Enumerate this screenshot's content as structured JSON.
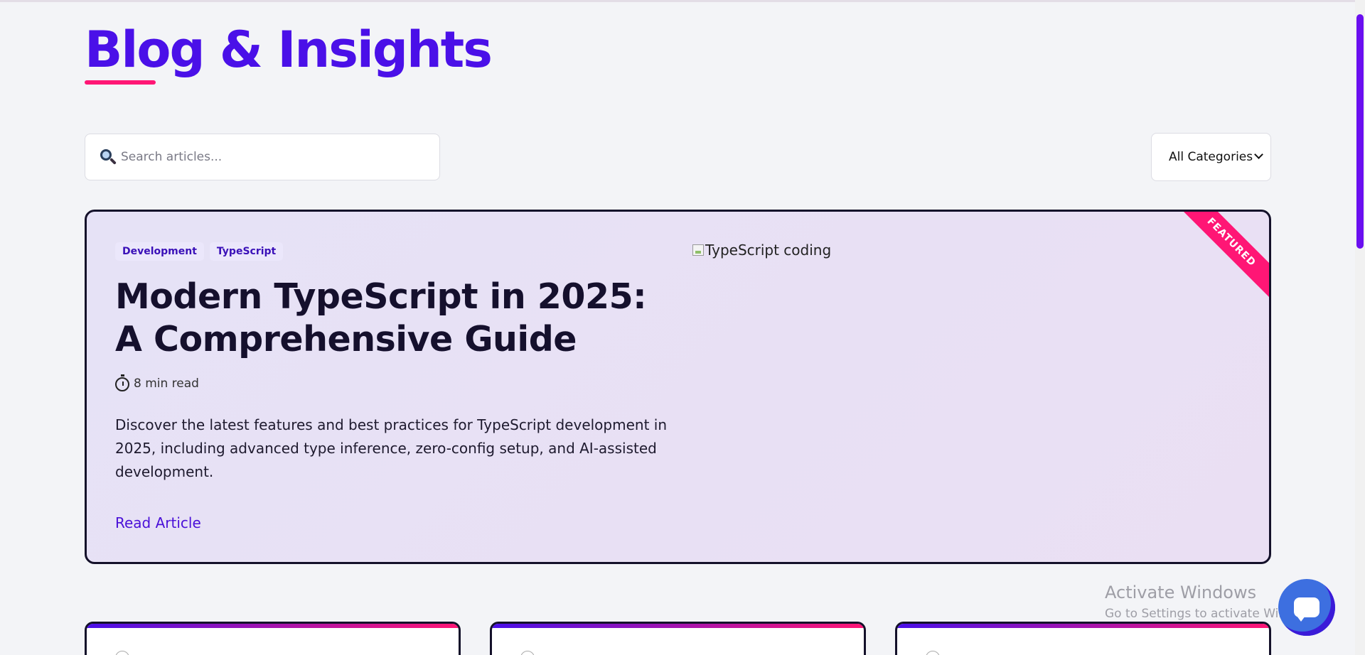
{
  "page": {
    "title": "Blog & Insights"
  },
  "search": {
    "placeholder": "Search articles..."
  },
  "category_filter": {
    "selected": "All Categories"
  },
  "featured": {
    "tags": [
      "Development",
      "TypeScript"
    ],
    "title": "Modern TypeScript in 2025: A Comprehensive Guide",
    "read_time": "8 min read",
    "excerpt": "Discover the latest features and best practices for TypeScript development in 2025, including advanced type inference, zero-config setup, and AI-assisted development.",
    "link_label": "Read Article",
    "image_alt": "TypeScript coding",
    "ribbon": "FEATURED"
  },
  "watermark": {
    "line1": "Activate Windows",
    "line2": "Go to Settings to activate Windows."
  },
  "colors": {
    "brand": "#4a10e8",
    "accent": "#ff1675",
    "dark": "#14112a"
  },
  "icons": [
    "search-icon",
    "chevron-down-icon",
    "stopwatch-icon",
    "broken-image-icon",
    "chat-icon"
  ]
}
